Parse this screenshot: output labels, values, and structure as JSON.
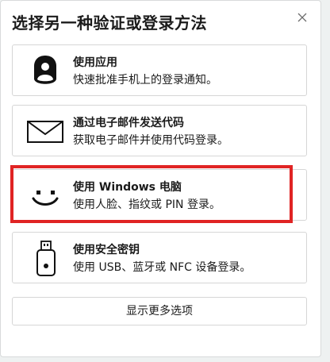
{
  "dialog": {
    "title": "选择另一种验证或登录方法",
    "close_icon": "close-icon"
  },
  "options": [
    {
      "title": "使用应用",
      "description": "快速批准手机上的登录通知。",
      "icon": "authenticator-app-icon"
    },
    {
      "title": "通过电子邮件发送代码",
      "description": "获取电子邮件并使用代码登录。",
      "icon": "email-icon"
    },
    {
      "title": "使用 Windows 电脑",
      "description": "使用人脸、指纹或 PIN 登录。",
      "icon": "windows-hello-face-icon"
    },
    {
      "title": "使用安全密钥",
      "description": "使用 USB、蓝牙或 NFC 设备登录。",
      "icon": "security-key-icon"
    }
  ],
  "more_options_label": "显示更多选项",
  "colors": {
    "highlight": "#e02424",
    "text": "#1b1b1b",
    "border": "#d6d6d6",
    "background": "#eef1f1"
  }
}
